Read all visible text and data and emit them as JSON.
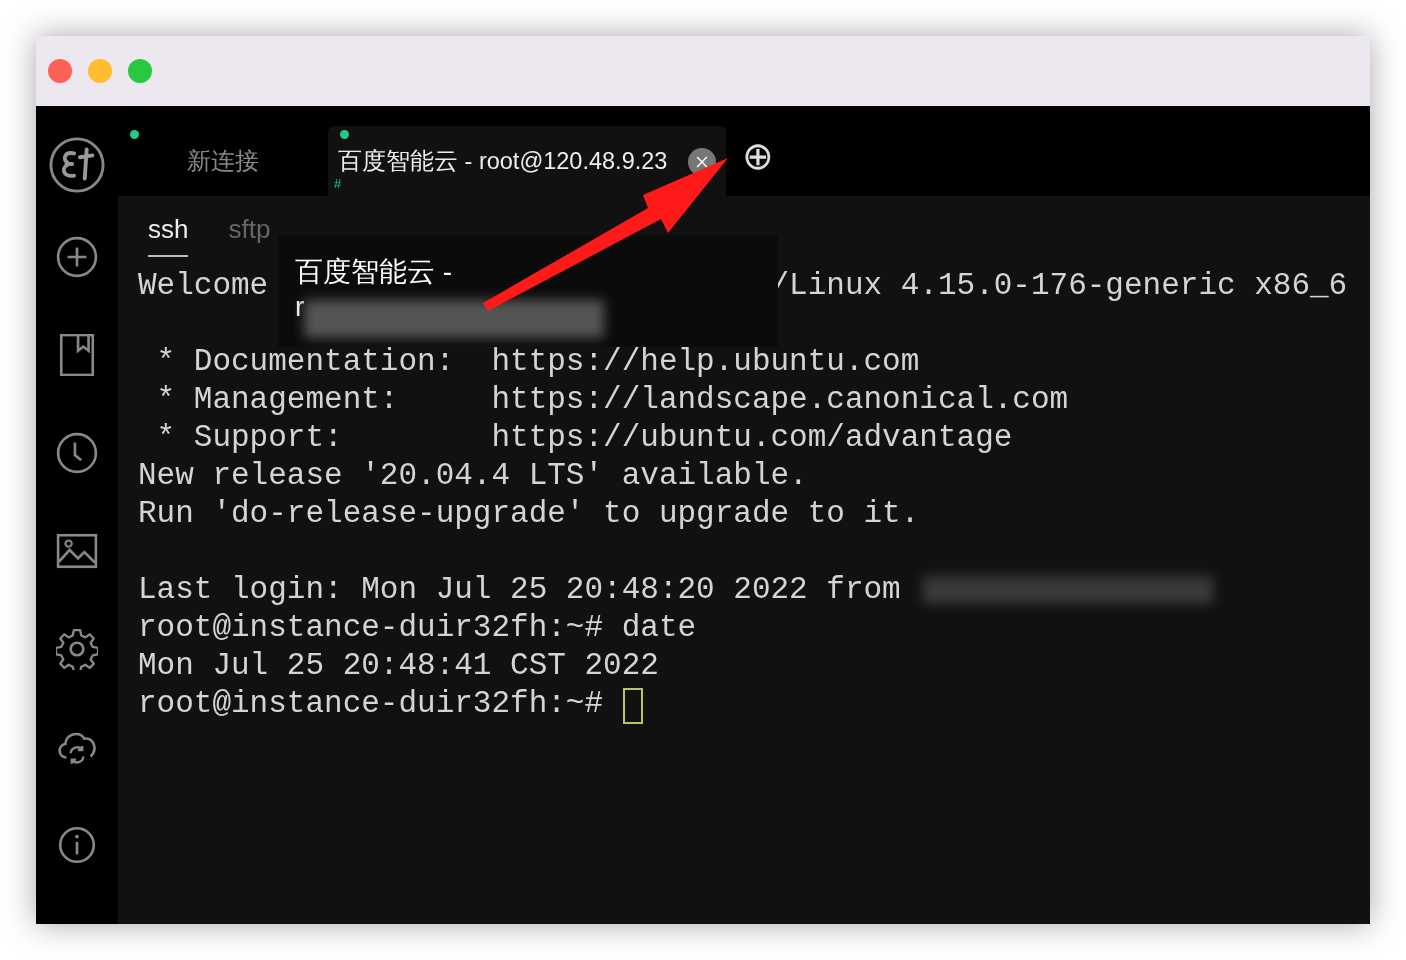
{
  "tabs": [
    {
      "label": "新连接",
      "connected": true,
      "selected": false,
      "closable": false
    },
    {
      "label": "百度智能云 - root@120.48.9.23",
      "connected": true,
      "selected": true,
      "closable": true,
      "glyph": "#"
    }
  ],
  "add_tab": "⊕",
  "sidebar": {
    "items": [
      {
        "kind": "add"
      },
      {
        "kind": "bookmarks"
      },
      {
        "kind": "history"
      },
      {
        "kind": "image"
      },
      {
        "kind": "settings"
      },
      {
        "kind": "sync"
      },
      {
        "kind": "info"
      }
    ]
  },
  "subtabs": [
    {
      "label": "ssh",
      "selected": true
    },
    {
      "label": "sftp",
      "selected": false
    }
  ],
  "tooltip": {
    "line_1": "百度智能云 -",
    "line_2": "r"
  },
  "terminal": {
    "lines": [
      {
        "kind": "covered",
        "before": "Welcome",
        "after": "/Linux 4.15.0-176-generic x86_6"
      },
      {
        "kind": "blank"
      },
      {
        "kind": "text",
        "text": " * Documentation:  https://help.ubuntu.com"
      },
      {
        "kind": "text",
        "text": " * Management:     https://landscape.canonical.com"
      },
      {
        "kind": "text",
        "text": " * Support:        https://ubuntu.com/advantage"
      },
      {
        "kind": "text",
        "text": "New release '20.04.4 LTS' available."
      },
      {
        "kind": "text",
        "text": "Run 'do-release-upgrade' to upgrade to it."
      },
      {
        "kind": "blank"
      },
      {
        "kind": "redacted",
        "text": "Last login: Mon Jul 25 20:48:20 2022 from"
      },
      {
        "kind": "text",
        "text": "root@instance-duir32fh:~# date"
      },
      {
        "kind": "text",
        "text": "Mon Jul 25 20:48:41 CST 2022"
      },
      {
        "kind": "cursor",
        "text": "root@instance-duir32fh:~#"
      }
    ]
  }
}
